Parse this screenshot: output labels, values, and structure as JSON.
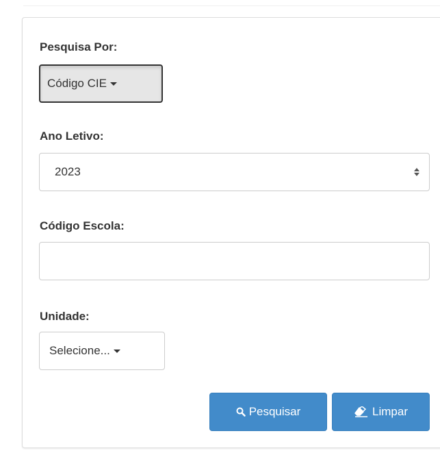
{
  "form": {
    "search_by": {
      "label": "Pesquisa Por:",
      "selected": "Código CIE"
    },
    "school_year": {
      "label": "Ano Letivo:",
      "value": "2023"
    },
    "school_code": {
      "label": "Código Escola:",
      "value": "",
      "placeholder": ""
    },
    "unit": {
      "label": "Unidade:",
      "selected": "Selecione..."
    }
  },
  "actions": {
    "search_label": "Pesquisar",
    "search_icon": "search-icon",
    "clear_label": "Limpar",
    "clear_icon": "eraser-icon"
  },
  "colors": {
    "primary": "#428bca",
    "active_dropdown_bg": "#e6e6e6",
    "border": "#cccccc",
    "text": "#333333"
  }
}
